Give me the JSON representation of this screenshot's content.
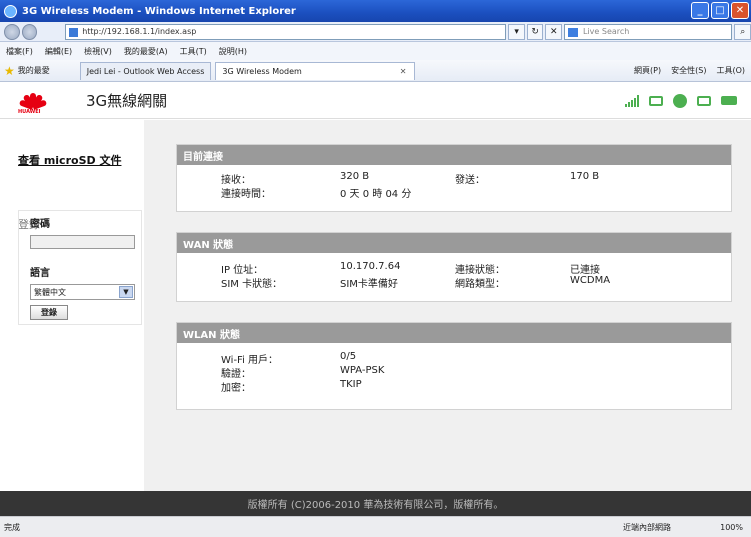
{
  "browser": {
    "title": "3G Wireless Modem - Windows Internet Explorer",
    "url": "http://192.168.1.1/index.asp",
    "search_placeholder": "Live Search",
    "menu": [
      "檔案(F)",
      "編輯(E)",
      "檢視(V)",
      "我的最愛(A)",
      "工具(T)",
      "說明(H)"
    ],
    "favorites_label": "我的最愛",
    "tabs": [
      "Jedi Lei - Outlook Web Access",
      "3G Wireless Modem"
    ],
    "toolbar_right": [
      "網頁(P)",
      "安全性(S)",
      "工具(O)"
    ],
    "status_left": "完成",
    "status_zone": "近端內部網路",
    "status_zoom": "100%"
  },
  "app": {
    "title": "3G無線網關",
    "brand": "HUAWEI"
  },
  "sidebar": {
    "microsd_link": "查看 microSD 文件",
    "login_heading": "登錄",
    "password_label": "密碼",
    "language_label": "語言",
    "language_value": "繁體中文",
    "login_button": "登錄"
  },
  "panels": {
    "current": {
      "title": "目前連接",
      "recv_label": "接收：",
      "recv_value": "320 B",
      "send_label": "發送：",
      "send_value": "170 B",
      "time_label": "連接時間：",
      "time_value": "0 天 0 時 04 分"
    },
    "wan": {
      "title": "WAN 狀態",
      "ip_label": "IP 位址：",
      "ip_value": "10.170.7.64",
      "conn_label": "連接狀態：",
      "conn_value": "已連接",
      "sim_label": "SIM 卡狀態：",
      "sim_value": "SIM卡準備好",
      "net_label": "網路類型：",
      "net_value": "WCDMA"
    },
    "wlan": {
      "title": "WLAN 狀態",
      "users_label": "Wi-Fi 用戶：",
      "users_value": "0/5",
      "auth_label": "驗證：",
      "auth_value": "WPA-PSK",
      "enc_label": "加密：",
      "enc_value": "TKIP"
    }
  },
  "footer": {
    "copyright": "版權所有 (C)2006-2010 華為技術有限公司，版權所有。"
  }
}
